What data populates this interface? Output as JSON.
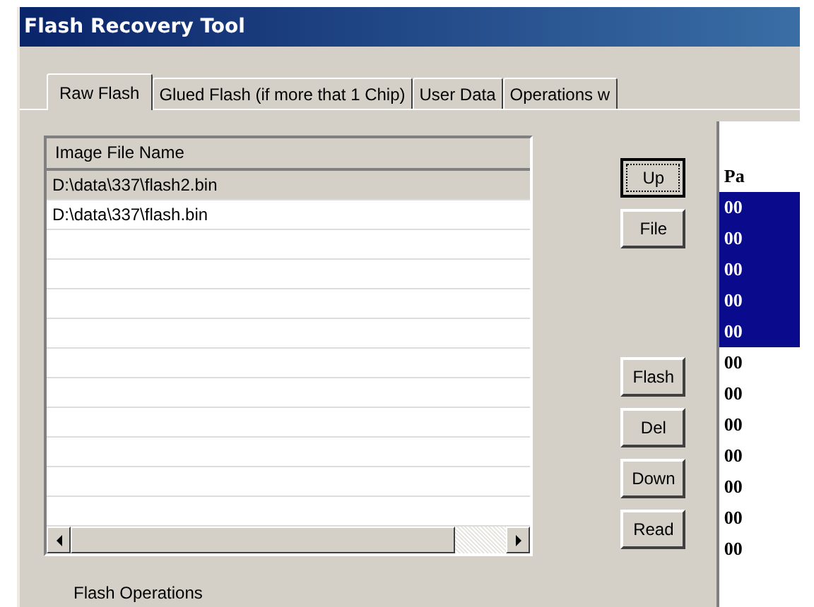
{
  "window": {
    "title": "Flash Recovery Tool"
  },
  "tabs": [
    {
      "label": "Raw Flash",
      "selected": true
    },
    {
      "label": "Glued Flash (if more that 1 Chip)",
      "selected": false
    },
    {
      "label": "User Data",
      "selected": false
    },
    {
      "label": "Operations w",
      "selected": false
    }
  ],
  "file_list": {
    "header": "Image File Name",
    "rows": [
      {
        "text": "D:\\data\\337\\flash2.bin",
        "selected": true
      },
      {
        "text": "D:\\data\\337\\flash.bin",
        "selected": false
      }
    ]
  },
  "top_buttons": [
    {
      "label": "Up",
      "focused": true
    },
    {
      "label": "File",
      "focused": false
    }
  ],
  "bottom_buttons": [
    {
      "label": "Flash",
      "focused": false
    },
    {
      "label": "Del",
      "focused": false
    },
    {
      "label": "Down",
      "focused": false
    },
    {
      "label": "Read",
      "focused": false
    }
  ],
  "page_list": {
    "header": "Pa",
    "rows": [
      {
        "text": "00",
        "selected": true
      },
      {
        "text": "00",
        "selected": true
      },
      {
        "text": "00",
        "selected": true
      },
      {
        "text": "00",
        "selected": true
      },
      {
        "text": "00",
        "selected": true
      },
      {
        "text": "00",
        "selected": false
      },
      {
        "text": "00",
        "selected": false
      },
      {
        "text": "00",
        "selected": false
      },
      {
        "text": "00",
        "selected": false
      },
      {
        "text": "00",
        "selected": false
      },
      {
        "text": "00",
        "selected": false
      },
      {
        "text": "00",
        "selected": false
      }
    ]
  },
  "group_box": {
    "label": "Flash Operations"
  }
}
